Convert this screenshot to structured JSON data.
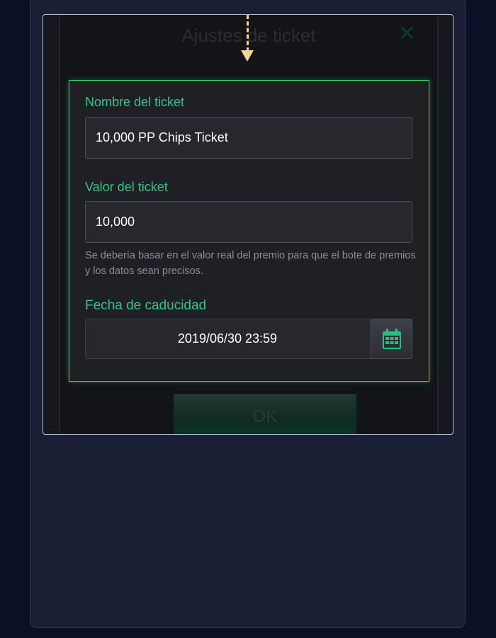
{
  "dialog": {
    "title": "Ajustes de ticket",
    "close_icon": "close-icon",
    "ok_label": "OK"
  },
  "form": {
    "name_label": "Nombre del ticket",
    "name_value": "10,000 PP Chips Ticket",
    "value_label": "Valor del ticket",
    "value_value": "10,000",
    "help_text": "Se debería basar en el valor real del premio para que el bote de premios y los datos sean precisos.",
    "expiry_label": "Fecha de caducidad",
    "expiry_value": "2019/06/30 23:59",
    "calendar_icon": "calendar-icon"
  },
  "colors": {
    "accent_green": "#2ed573",
    "label_green": "#2ec48c",
    "arrow": "#f6d39a",
    "page_bg": "#0b1024",
    "panel_bg": "#1b1f36"
  }
}
